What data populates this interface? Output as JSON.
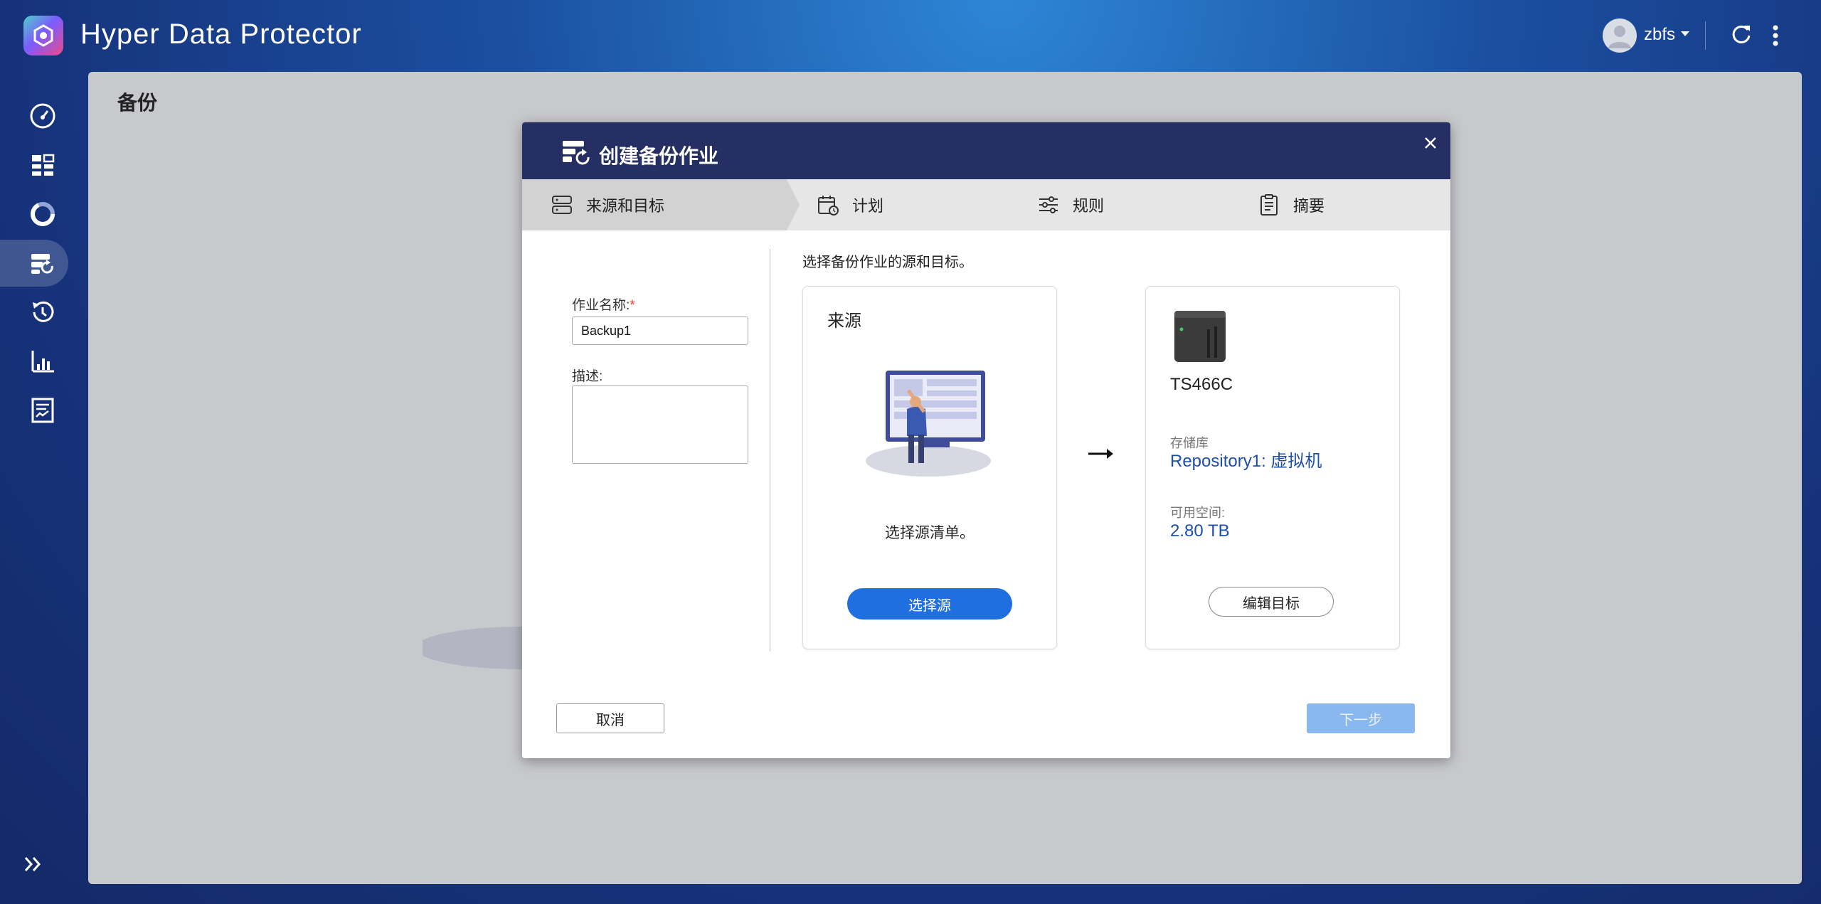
{
  "app": {
    "title": "Hyper Data Protector"
  },
  "user": {
    "name": "zbfs"
  },
  "page": {
    "title": "备份"
  },
  "sidebar": {
    "items": [
      {
        "icon": "dashboard-gauge-icon"
      },
      {
        "icon": "overview-grid-icon"
      },
      {
        "icon": "storage-ring-icon"
      },
      {
        "icon": "backup-icon",
        "active": true
      },
      {
        "icon": "restore-icon"
      },
      {
        "icon": "reports-icon"
      },
      {
        "icon": "logs-icon"
      }
    ]
  },
  "modal": {
    "title": "创建备份作业",
    "steps": [
      {
        "label": "来源和目标",
        "icon": "source-target-icon",
        "active": true
      },
      {
        "label": "计划",
        "icon": "calendar-clock-icon"
      },
      {
        "label": "规则",
        "icon": "sliders-icon"
      },
      {
        "label": "摘要",
        "icon": "summary-clipboard-icon"
      }
    ],
    "form": {
      "job_name_label": "作业名称:",
      "required_mark": "*",
      "job_name_value": "Backup1",
      "description_label": "描述:",
      "description_value": ""
    },
    "instruction": "选择备份作业的源和目标。",
    "source_card": {
      "title": "来源",
      "hint": "选择源清单。",
      "button": "选择源"
    },
    "target_card": {
      "device_name": "TS466C",
      "repository_label": "存储库",
      "repository_value": "Repository1: 虚拟机",
      "free_space_label": "可用空间:",
      "free_space_value": "2.80 TB",
      "button": "编辑目标"
    },
    "footer": {
      "cancel": "取消",
      "next": "下一步"
    }
  },
  "colors": {
    "header": "#252f63",
    "primary": "#1f6fe0",
    "link": "#1d4ea8",
    "disabled": "#8ab7ee"
  }
}
